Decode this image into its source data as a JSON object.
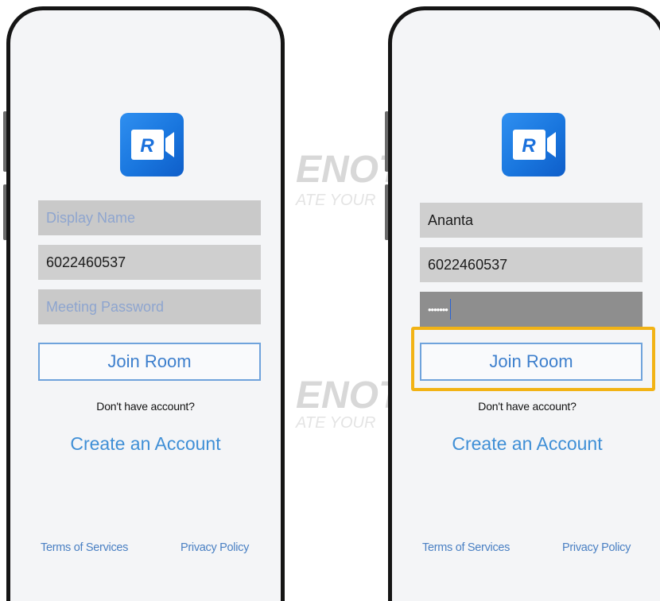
{
  "app": {
    "logo_letter": "R",
    "brand_gradient": [
      "#2f8ff0",
      "#0f5ec9"
    ]
  },
  "screens": [
    {
      "fields": {
        "display_name": {
          "value": "",
          "placeholder": "Display Name"
        },
        "meeting_id": {
          "value": "6022460537"
        },
        "password": {
          "value": "",
          "placeholder": "Meeting Password"
        }
      },
      "join_label": "Join Room",
      "no_account_text": "Don't have account?",
      "create_account_label": "Create an Account",
      "footer": {
        "terms": "Terms of Services",
        "privacy": "Privacy Policy"
      }
    },
    {
      "fields": {
        "display_name": {
          "value": "Ananta"
        },
        "meeting_id": {
          "value": "6022460537"
        },
        "password": {
          "masked": "•••••••"
        }
      },
      "join_label": "Join Room",
      "no_account_text": "Don't have account?",
      "create_account_label": "Create an Account",
      "footer": {
        "terms": "Terms of Services",
        "privacy": "Privacy Policy"
      }
    }
  ],
  "watermark": {
    "lines": [
      "ENOTE",
      "ATE YOUR"
    ]
  },
  "annotation": {
    "highlight_color": "#f2b315"
  }
}
